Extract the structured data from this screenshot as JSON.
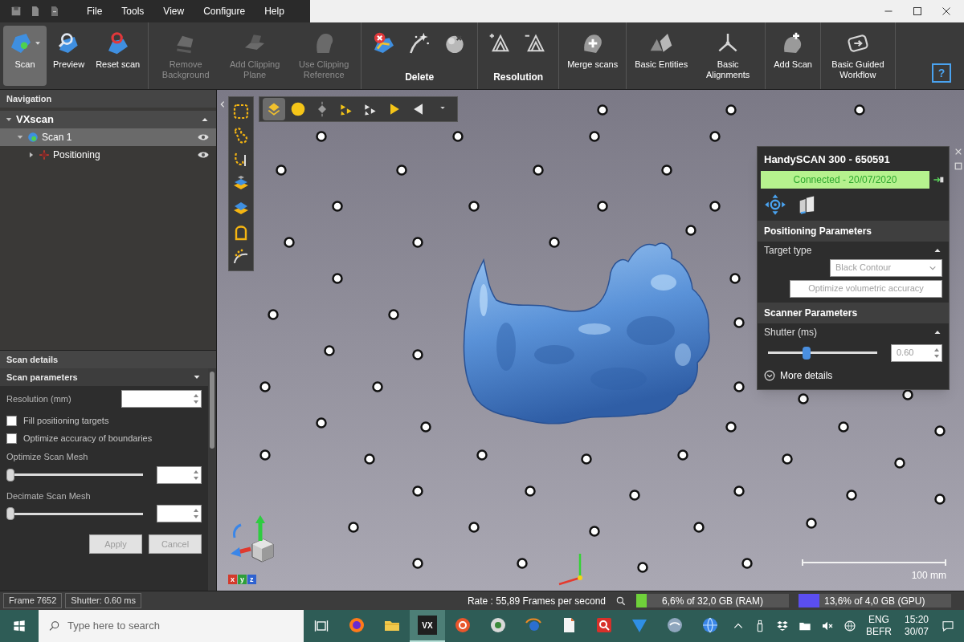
{
  "menu": [
    "File",
    "Tools",
    "View",
    "Configure",
    "Help"
  ],
  "ribbon": {
    "sections": [
      {
        "kind": "buttons",
        "buttons": [
          {
            "label": "Scan",
            "selected": true,
            "disabled": false,
            "dropdown": true
          },
          {
            "label": "Preview",
            "selected": false,
            "disabled": false,
            "dropdown": false
          },
          {
            "label": "Reset scan",
            "selected": false,
            "disabled": false,
            "dropdown": false
          }
        ]
      },
      {
        "kind": "buttons",
        "buttons": [
          {
            "label": "Remove Background",
            "selected": false,
            "disabled": true,
            "dropdown": false
          },
          {
            "label": "Add Clipping Plane",
            "selected": false,
            "disabled": true,
            "dropdown": false
          },
          {
            "label": "Use Clipping Reference",
            "selected": false,
            "disabled": true,
            "dropdown": false
          }
        ]
      },
      {
        "kind": "delete",
        "caption": "Delete"
      },
      {
        "kind": "resolution",
        "caption": "Resolution"
      },
      {
        "kind": "buttons",
        "buttons": [
          {
            "label": "Merge scans",
            "selected": false,
            "disabled": false,
            "dropdown": false
          }
        ]
      },
      {
        "kind": "buttons",
        "buttons": [
          {
            "label": "Basic Entities",
            "selected": false,
            "disabled": false,
            "dropdown": false
          },
          {
            "label": "Basic Alignments",
            "selected": false,
            "disabled": false,
            "dropdown": false
          }
        ]
      },
      {
        "kind": "buttons",
        "buttons": [
          {
            "label": "Add Scan",
            "selected": false,
            "disabled": false,
            "dropdown": false
          }
        ]
      },
      {
        "kind": "buttons",
        "buttons": [
          {
            "label": "Basic Guided Workflow",
            "selected": false,
            "disabled": false,
            "dropdown": false
          }
        ]
      }
    ],
    "help": "?"
  },
  "navigation": {
    "title": "Navigation",
    "tree": [
      {
        "label": "VXscan",
        "expanded": true,
        "selected": false,
        "children": [
          {
            "label": "Scan 1",
            "expanded": true,
            "selected": true,
            "children": [
              {
                "label": "Positioning",
                "expanded": false,
                "selected": false
              }
            ]
          }
        ]
      }
    ]
  },
  "scan_details": {
    "title": "Scan details",
    "section": {
      "title": "Scan parameters",
      "expanded": true
    },
    "rows": [
      {
        "kind": "field",
        "label": "Resolution (mm)"
      },
      {
        "kind": "checkbox",
        "label": "Fill positioning targets",
        "checked": false
      },
      {
        "kind": "checkbox",
        "label": "Optimize accuracy of boundaries",
        "checked": false
      },
      {
        "kind": "slider",
        "label": "Optimize Scan Mesh",
        "level": 0
      },
      {
        "kind": "slider",
        "label": "Decimate Scan Mesh",
        "level": 0
      }
    ],
    "buttons": [
      {
        "label": "Apply",
        "disabled": true
      },
      {
        "label": "Cancel",
        "disabled": true
      }
    ]
  },
  "viewport": {
    "toolbar": [
      {
        "selected": true
      },
      {
        "selected": false
      },
      {
        "selected": false
      },
      {
        "selected": false
      },
      {
        "selected": false
      },
      {
        "selected": false
      },
      {
        "selected": false
      },
      {
        "selected": false
      }
    ],
    "axis_labels": [
      "x",
      "y",
      "z"
    ],
    "scale": "100 mm"
  },
  "scanner_panel": {
    "title": "HandySCAN 300 - 650591",
    "connection": {
      "text": "Connected - 20/07/2020",
      "connected": true
    },
    "sections": [
      {
        "kind": "positioning",
        "title": "Positioning Parameters",
        "expanded": true,
        "target_label": "Target type",
        "target_value": "Black Contour",
        "option": "Optimize volumetric accuracy",
        "disabled": true
      },
      {
        "kind": "scanner",
        "title": "Scanner Parameters",
        "expanded": true,
        "shutter_label": "Shutter (ms)",
        "level": 0.35,
        "value": "0.60",
        "disabled": true
      }
    ],
    "more": "More details"
  },
  "app_status": {
    "frame": "Frame 7652",
    "shutter": "Shutter: 0.60 ms",
    "rate": "Rate : 55,89 Frames per second",
    "ram": {
      "text": "6,6% of 32,0 GB (RAM)",
      "level": 0.066
    },
    "gpu": {
      "text": "13,6% of 4,0 GB (GPU)",
      "level": 0.136
    }
  },
  "taskbar": {
    "search": {
      "placeholder": "Type here to search"
    },
    "apps": [
      {
        "selected": false
      },
      {
        "selected": false
      },
      {
        "label": "VX",
        "selected": true
      },
      {
        "selected": false
      },
      {
        "selected": false
      },
      {
        "selected": false
      },
      {
        "selected": false
      },
      {
        "selected": false
      },
      {
        "selected": false
      },
      {
        "selected": false
      },
      {
        "selected": false
      }
    ],
    "tray": {
      "language": "ENG",
      "layout": "BEFR",
      "time": "15:20",
      "date": "30/07"
    }
  }
}
